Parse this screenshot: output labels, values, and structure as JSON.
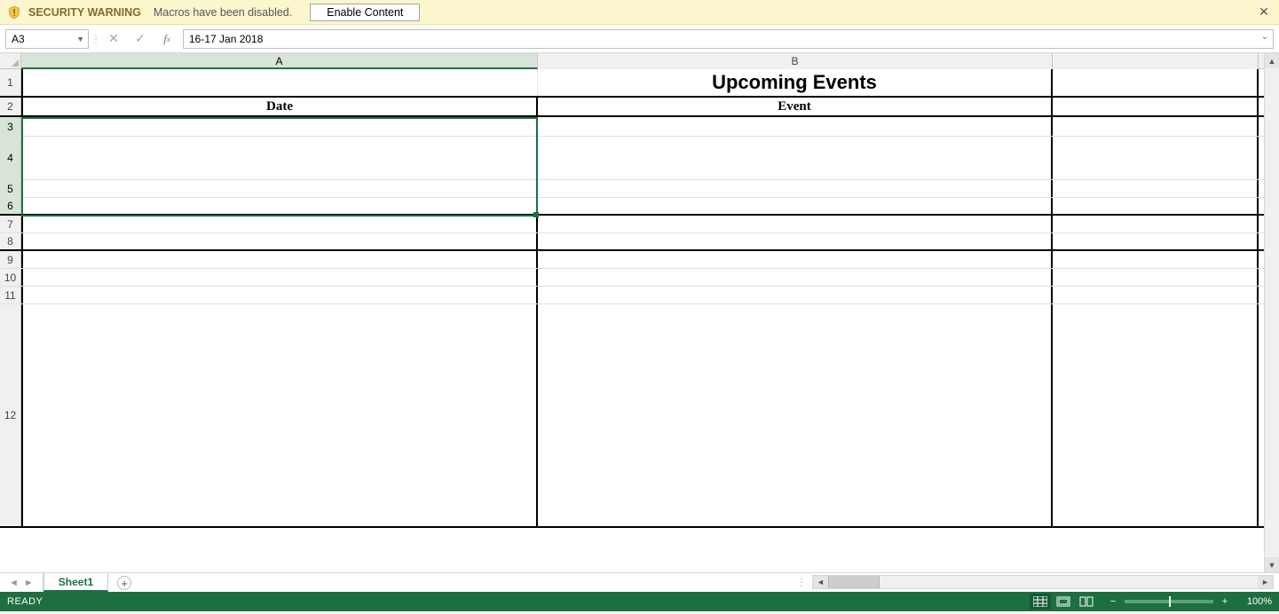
{
  "warning": {
    "title": "SECURITY WARNING",
    "msg": "Macros have been disabled.",
    "button": "Enable Content"
  },
  "namebox": "A3",
  "formula": "16-17 Jan 2018",
  "columns": {
    "A": "A",
    "B": "B"
  },
  "rows": [
    "1",
    "2",
    "3",
    "4",
    "5",
    "6",
    "7",
    "8",
    "9",
    "10",
    "11",
    "12"
  ],
  "sheet": {
    "title": "Upcoming Events",
    "header_date": "Date",
    "header_event": "Event"
  },
  "tabs": {
    "sheet1": "Sheet1"
  },
  "status": {
    "ready": "READY",
    "zoom": "100%"
  }
}
